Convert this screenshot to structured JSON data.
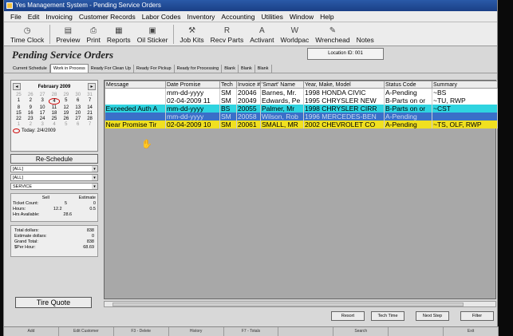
{
  "window": {
    "title": "Yes Management System - Pending Service Orders"
  },
  "menu": [
    "File",
    "Edit",
    "Invoicing",
    "Customer Records",
    "Labor Codes",
    "Inventory",
    "Accounting",
    "Utilities",
    "Window",
    "Help"
  ],
  "toolbar": [
    {
      "label": "Time Clock",
      "icon": "clock-icon",
      "glyph": "◷"
    },
    {
      "label": "Preview",
      "icon": "preview-icon",
      "glyph": "▤"
    },
    {
      "label": "Print",
      "icon": "print-icon",
      "glyph": "⎙"
    },
    {
      "label": "Reports",
      "icon": "reports-icon",
      "glyph": "▦"
    },
    {
      "label": "Oil Sticker",
      "icon": "oil-sticker-icon",
      "glyph": "▣"
    },
    {
      "label": "Job Kits",
      "icon": "job-kits-icon",
      "glyph": "⚒"
    },
    {
      "label": "Recv Parts",
      "icon": "recv-parts-icon",
      "glyph": "R"
    },
    {
      "label": "Activant",
      "icon": "activant-icon",
      "glyph": "A"
    },
    {
      "label": "Worldpac",
      "icon": "worldpac-icon",
      "glyph": "W"
    },
    {
      "label": "Wrenchead",
      "icon": "wrenchead-icon",
      "glyph": "✎"
    },
    {
      "label": "Notes",
      "icon": "notes-icon",
      "glyph": ""
    }
  ],
  "header": {
    "title": "Pending Service Orders",
    "location": "Location ID: 001"
  },
  "tabs": [
    "Current Schedule",
    "Work in Process",
    "Ready For Clean Up",
    "Ready For Pickup",
    "Ready for Processing",
    "Blank",
    "Blank",
    "Blank"
  ],
  "calendar": {
    "month": "February 2009",
    "days": [
      {
        "d": "25",
        "g": 1
      },
      {
        "d": "26",
        "g": 1
      },
      {
        "d": "27",
        "g": 1
      },
      {
        "d": "28",
        "g": 1
      },
      {
        "d": "29",
        "g": 1
      },
      {
        "d": "30",
        "g": 1
      },
      {
        "d": "31",
        "g": 1
      },
      {
        "d": "1"
      },
      {
        "d": "2"
      },
      {
        "d": "3"
      },
      {
        "d": "4",
        "s": 1
      },
      {
        "d": "5"
      },
      {
        "d": "6"
      },
      {
        "d": "7"
      },
      {
        "d": "8"
      },
      {
        "d": "9"
      },
      {
        "d": "10"
      },
      {
        "d": "11"
      },
      {
        "d": "12"
      },
      {
        "d": "13"
      },
      {
        "d": "14"
      },
      {
        "d": "15"
      },
      {
        "d": "16"
      },
      {
        "d": "17"
      },
      {
        "d": "18"
      },
      {
        "d": "19"
      },
      {
        "d": "20"
      },
      {
        "d": "21"
      },
      {
        "d": "22"
      },
      {
        "d": "23"
      },
      {
        "d": "24"
      },
      {
        "d": "25"
      },
      {
        "d": "26"
      },
      {
        "d": "27"
      },
      {
        "d": "28"
      },
      {
        "d": "1",
        "g": 1
      },
      {
        "d": "2",
        "g": 1
      },
      {
        "d": "3",
        "g": 1
      },
      {
        "d": "4",
        "g": 1
      },
      {
        "d": "5",
        "g": 1
      },
      {
        "d": "6",
        "g": 1
      },
      {
        "d": "7",
        "g": 1
      }
    ],
    "today": "Today: 2/4/2009"
  },
  "reschedule_label": "Re-Schedule",
  "filters": [
    "[ALL]",
    "[ALL]",
    "SERVICE"
  ],
  "stats": {
    "col_sell": "Sell",
    "col_estimate": "Estimate",
    "rows": [
      {
        "label": "Ticket Count:",
        "sell": "5",
        "est": "0"
      },
      {
        "label": "Hours:",
        "sell": "12.2",
        "est": "0.5"
      },
      {
        "label": "Hrs Available:",
        "sell": "28.6",
        "est": ""
      }
    ]
  },
  "totals": [
    {
      "label": "Total dollars:",
      "value": "838"
    },
    {
      "label": "Estimate dollars:",
      "value": "0"
    },
    {
      "label": "Grand Total:",
      "value": "838"
    },
    {
      "label": "$Per Hour:",
      "value": "68.69"
    }
  ],
  "tire_quote_label": "Tire Quote",
  "columns": [
    "Message",
    "Date Promise",
    "Tech",
    "Invoice #",
    "'Smart' Name",
    "Year, Make, Model",
    "Status Code",
    "Summary"
  ],
  "rows": [
    {
      "style": "white",
      "cells": [
        "",
        "mm-dd-yyyy",
        "SM",
        "20046",
        "Barnes, Mr.",
        "1998 HONDA CIVIC",
        "A-Pending",
        "~BS"
      ]
    },
    {
      "style": "white",
      "cells": [
        "",
        "02-04-2009 11",
        "SM",
        "20049",
        "Edwards, Pe",
        "1995 CHRYSLER NEW",
        "B-Parts on or",
        "~TU, RWP"
      ]
    },
    {
      "style": "cyan",
      "cells": [
        "Exceeded Auth A",
        "mm-dd-yyyy",
        "BS",
        "20055",
        "Palmer, Mr",
        "1998 CHRYSLER CIRR",
        "B-Parts on or",
        "~CST"
      ]
    },
    {
      "style": "blue",
      "cells": [
        "",
        "mm-dd-yyyy",
        "SM",
        "20058",
        "Wilson, Rob",
        "1996 MERCEDES-BEN",
        "A-Pending",
        ""
      ]
    },
    {
      "style": "yellow",
      "cells": [
        "Near Promise Tir",
        "02-04-2009 10",
        "SM",
        "20061",
        "SMALL, MR",
        "2002 CHEVROLET CO",
        "A-Pending",
        "~TS, OLF, RWP"
      ]
    }
  ],
  "bottom_buttons": [
    "Resort",
    "Tech Time",
    "Next Step",
    "Filter"
  ],
  "fkeys": [
    "Add",
    "Edit Customer",
    "F3 - Delete",
    "History",
    "F7 - Totals",
    "",
    "Search",
    "",
    "Exit"
  ]
}
